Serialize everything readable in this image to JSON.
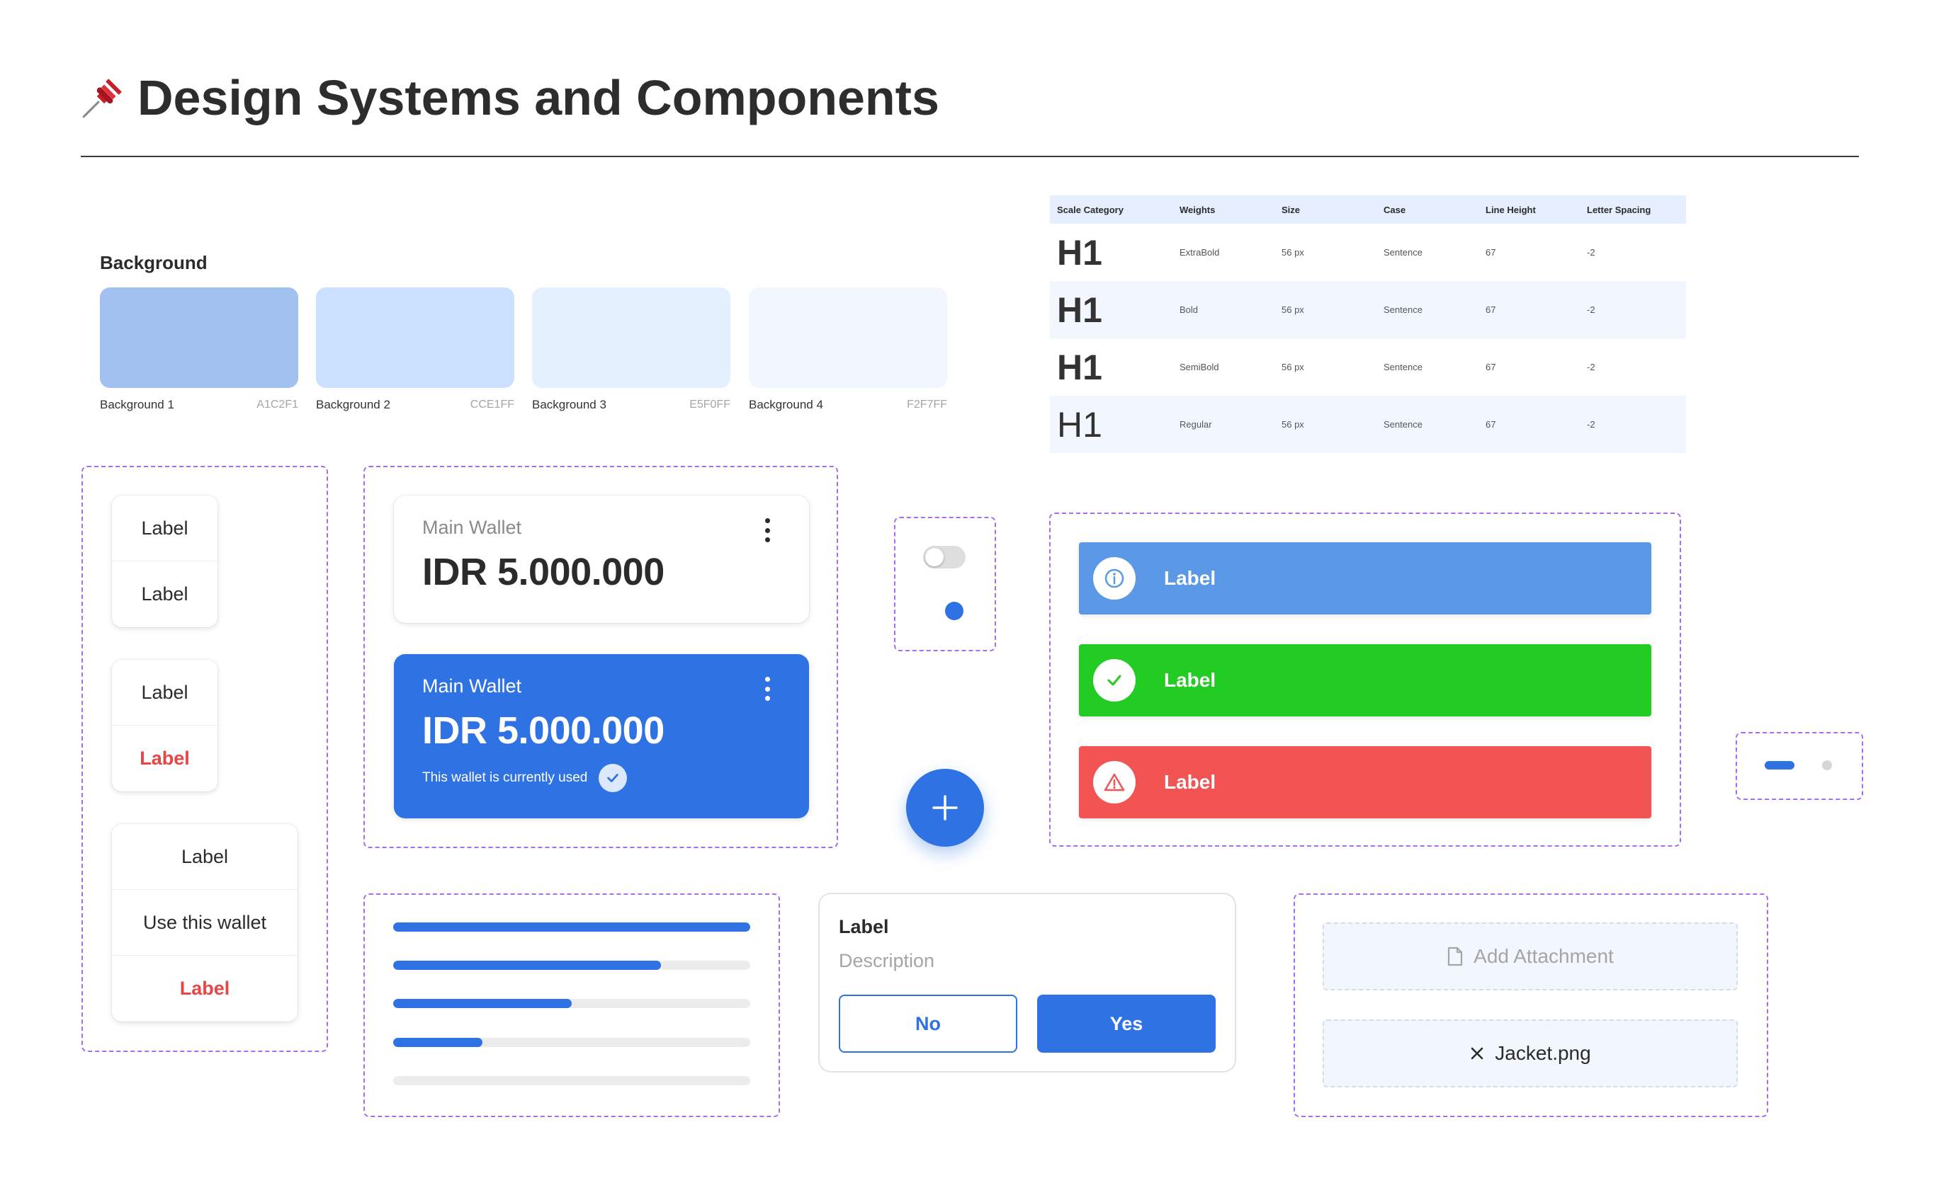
{
  "header": {
    "title": "Design Systems and Components",
    "icon": "pushpin-icon"
  },
  "background": {
    "title": "Background",
    "swatches": [
      {
        "name": "Background 1",
        "hex": "A1C2F1",
        "color": "#A1C2F1"
      },
      {
        "name": "Background 2",
        "hex": "CCE1FF",
        "color": "#CCE1FF"
      },
      {
        "name": "Background 3",
        "hex": "E5F0FF",
        "color": "#E5F0FF"
      },
      {
        "name": "Background 4",
        "hex": "F2F7FF",
        "color": "#F2F7FF"
      }
    ]
  },
  "typography": {
    "headers": [
      "Scale Category",
      "Weights",
      "Size",
      "Case",
      "Line Height",
      "Letter Spacing"
    ],
    "rows": [
      {
        "sample": "H1",
        "weight": "ExtraBold",
        "size": "56 px",
        "case": "Sentence",
        "line_height": "67",
        "letter_spacing": "-2"
      },
      {
        "sample": "H1",
        "weight": "Bold",
        "size": "56 px",
        "case": "Sentence",
        "line_height": "67",
        "letter_spacing": "-2"
      },
      {
        "sample": "H1",
        "weight": "SemiBold",
        "size": "56 px",
        "case": "Sentence",
        "line_height": "67",
        "letter_spacing": "-2"
      },
      {
        "sample": "H1",
        "weight": "Regular",
        "size": "56 px",
        "case": "Sentence",
        "line_height": "67",
        "letter_spacing": "-2"
      }
    ]
  },
  "menus": {
    "menu1": [
      "Label",
      "Label"
    ],
    "menu2": [
      "Label",
      "Label"
    ],
    "menu3": [
      "Label",
      "Use this wallet",
      "Label"
    ]
  },
  "wallets": {
    "white": {
      "label": "Main Wallet",
      "amount": "IDR 5.000.000"
    },
    "blue": {
      "label": "Main Wallet",
      "amount": "IDR 5.000.000",
      "note": "This wallet is currently used"
    }
  },
  "alerts": [
    {
      "label": "Label",
      "color": "#5B98E6",
      "icon": "info-icon"
    },
    {
      "label": "Label",
      "color": "#22CC22",
      "icon": "check-icon"
    },
    {
      "label": "Label",
      "color": "#F25454",
      "icon": "warning-icon"
    }
  ],
  "progress": [
    1.0,
    0.75,
    0.5,
    0.25,
    0.0
  ],
  "dialog": {
    "title": "Label",
    "description": "Description",
    "no": "No",
    "yes": "Yes"
  },
  "attachments": {
    "add": "Add Attachment",
    "file": "Jacket.png"
  },
  "colors": {
    "primary": "#2F72E3",
    "danger": "#E84545",
    "frame": "#A86CF0"
  }
}
